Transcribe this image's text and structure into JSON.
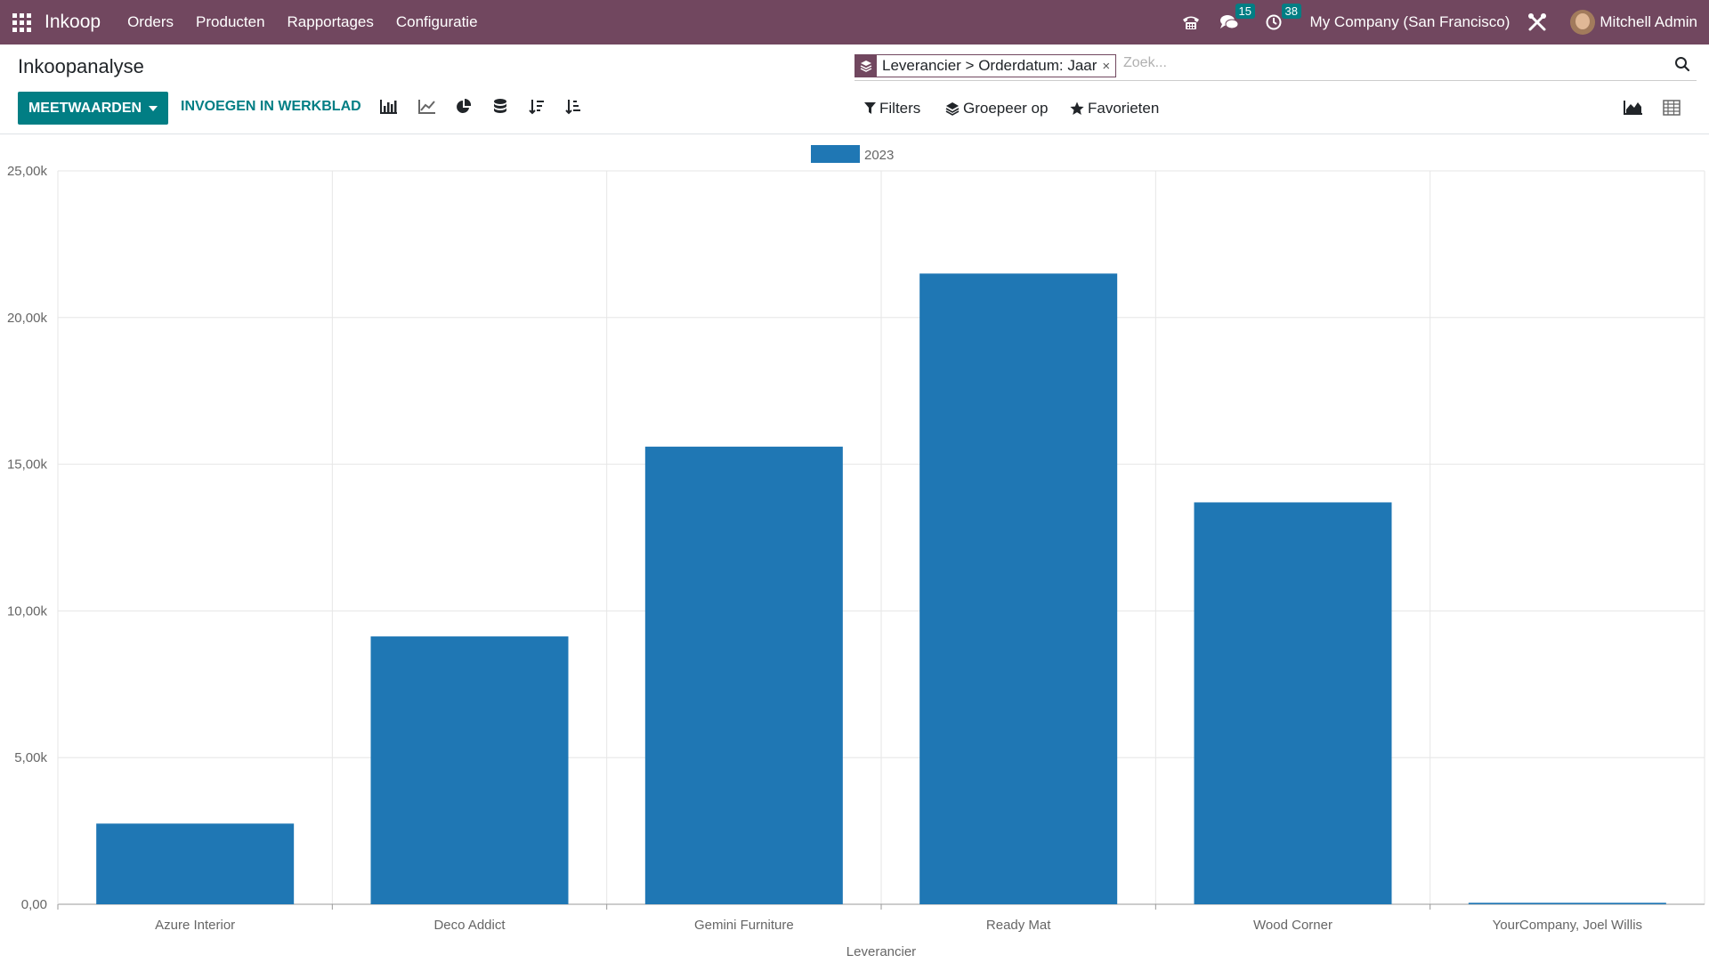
{
  "navbar": {
    "brand": "Inkoop",
    "menu": [
      "Orders",
      "Producten",
      "Rapportages",
      "Configuratie"
    ],
    "chat_badge": "15",
    "activity_badge": "38",
    "company": "My Company (San Francisco)",
    "user": "Mitchell Admin"
  },
  "page": {
    "title": "Inkoopanalyse"
  },
  "search": {
    "facet": "Leverancier > Orderdatum: Jaar",
    "facet_close": "×",
    "placeholder": "Zoek..."
  },
  "toolbar": {
    "measures": "MEETWAARDEN",
    "insert": "INVOEGEN IN WERKBLAD",
    "filters": "Filters",
    "group_by": "Groepeer op",
    "favorites": "Favorieten"
  },
  "colors": {
    "navbar": "#71475f",
    "primary": "#017e84",
    "bar": "#1f77b4"
  },
  "chart_data": {
    "type": "bar",
    "categories": [
      "Azure Interior",
      "Deco Addict",
      "Gemini Furniture",
      "Ready Mat",
      "Wood Corner",
      "YourCompany, Joel Willis"
    ],
    "series": [
      {
        "name": "2023",
        "values": [
          2750,
          9130,
          15600,
          21500,
          13700,
          50
        ]
      }
    ],
    "xlabel": "Leverancier",
    "ylabel": "",
    "ylim": [
      0,
      25000
    ],
    "yticks": [
      "0,00",
      "5,00k",
      "10,00k",
      "15,00k",
      "20,00k",
      "25,00k"
    ],
    "grid": true,
    "legend": "top"
  }
}
